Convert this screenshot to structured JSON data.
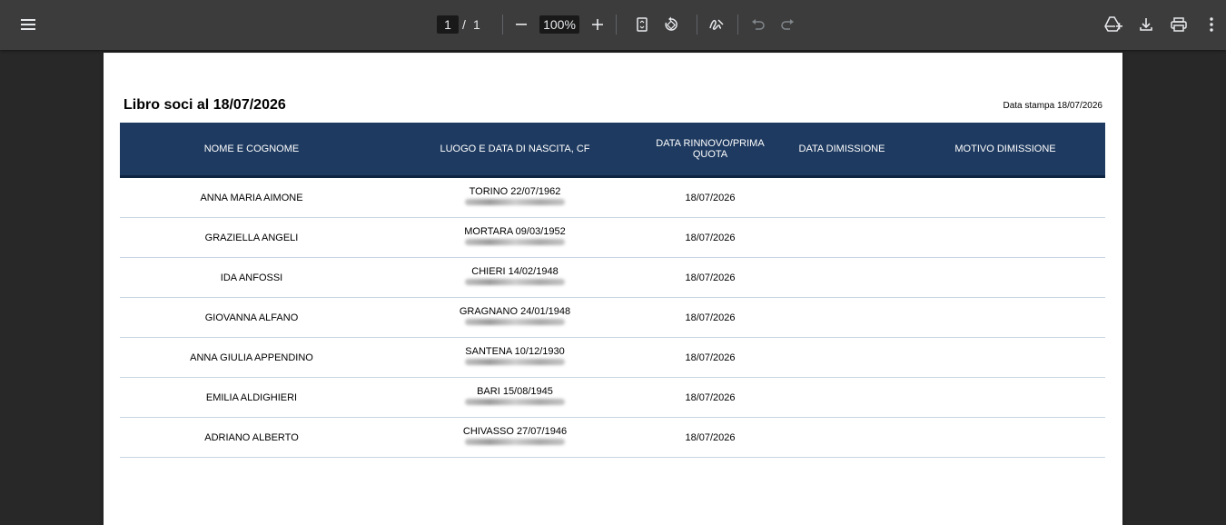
{
  "toolbar": {
    "menu_icon": "menu-icon",
    "current_page": "1",
    "page_separator": "/",
    "total_pages": "1",
    "zoom": "100%",
    "icons": [
      "menu-icon",
      "minus-icon",
      "plus-icon",
      "fit-page-icon",
      "rotate-icon",
      "annotate-icon",
      "undo-icon",
      "redo-icon",
      "drive-icon",
      "download-icon",
      "print-icon",
      "more-icon"
    ]
  },
  "document": {
    "title": "Libro soci al 18/07/2026",
    "print_date": "Data stampa 18/07/2026",
    "columns": [
      "NOME E COGNOME",
      "LUOGO E DATA DI NASCITA, CF",
      "DATA RINNOVO/PRIMA QUOTA",
      "DATA DIMISSIONE",
      "MOTIVO DIMISSIONE"
    ],
    "rows": [
      {
        "name": "ANNA MARIA AIMONE",
        "birth": "TORINO 22/07/1962",
        "renewal": "18/07/2026",
        "resignation": "",
        "reason": ""
      },
      {
        "name": "GRAZIELLA ANGELI",
        "birth": "MORTARA 09/03/1952",
        "renewal": "18/07/2026",
        "resignation": "",
        "reason": ""
      },
      {
        "name": "IDA ANFOSSI",
        "birth": "CHIERI 14/02/1948",
        "renewal": "18/07/2026",
        "resignation": "",
        "reason": ""
      },
      {
        "name": "GIOVANNA ALFANO",
        "birth": "GRAGNANO 24/01/1948",
        "renewal": "18/07/2026",
        "resignation": "",
        "reason": ""
      },
      {
        "name": "ANNA GIULIA APPENDINO",
        "birth": "SANTENA 10/12/1930",
        "renewal": "18/07/2026",
        "resignation": "",
        "reason": ""
      },
      {
        "name": "EMILIA ALDIGHIERI",
        "birth": "BARI 15/08/1945",
        "renewal": "18/07/2026",
        "resignation": "",
        "reason": ""
      },
      {
        "name": "ADRIANO ALBERTO",
        "birth": "CHIVASSO 27/07/1946",
        "renewal": "18/07/2026",
        "resignation": "",
        "reason": ""
      }
    ]
  },
  "colors": {
    "toolbar_bg": "#3c3c3c",
    "viewer_bg": "#282828",
    "header_bg": "#1e3a60",
    "row_border": "#c9d5e2"
  }
}
